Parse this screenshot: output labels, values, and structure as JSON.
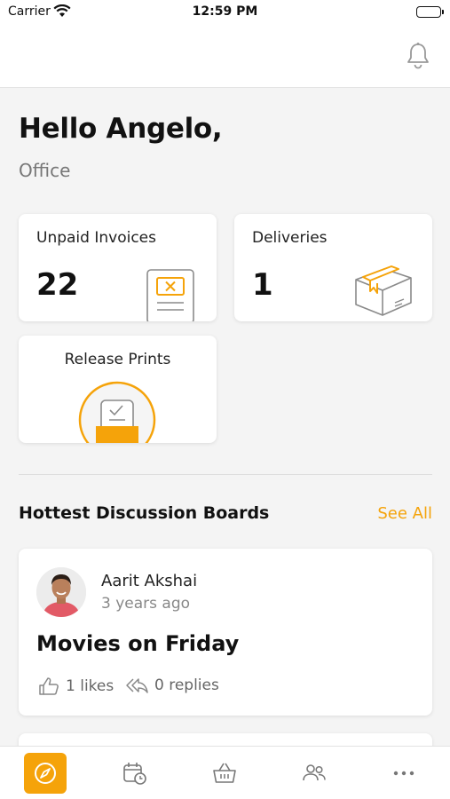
{
  "status_bar": {
    "carrier": "Carrier",
    "time": "12:59 PM"
  },
  "header": {
    "icons": [
      "bell-icon"
    ]
  },
  "greeting": {
    "title": "Hello Angelo,",
    "location": "Office"
  },
  "cards": {
    "unpaid_invoices": {
      "label": "Unpaid Invoices",
      "count": "22",
      "icon": "invoice-icon"
    },
    "deliveries": {
      "label": "Deliveries",
      "count": "1",
      "icon": "package-icon"
    },
    "release_prints": {
      "label": "Release Prints",
      "icon": "print-tray-icon"
    }
  },
  "discussions": {
    "title": "Hottest Discussion Boards",
    "see_all": "See All",
    "posts": [
      {
        "author": "Aarit Akshai",
        "time": "3 years ago",
        "title": "Movies on Friday",
        "likes": "1 likes",
        "replies": "0 replies"
      }
    ]
  },
  "tab_bar": {
    "items": [
      "compass-icon",
      "calendar-clock-icon",
      "basket-icon",
      "people-icon",
      "more-icon"
    ],
    "active_index": 0
  },
  "colors": {
    "accent": "#f5a30a",
    "background": "#f4f4f4",
    "card": "#ffffff"
  }
}
